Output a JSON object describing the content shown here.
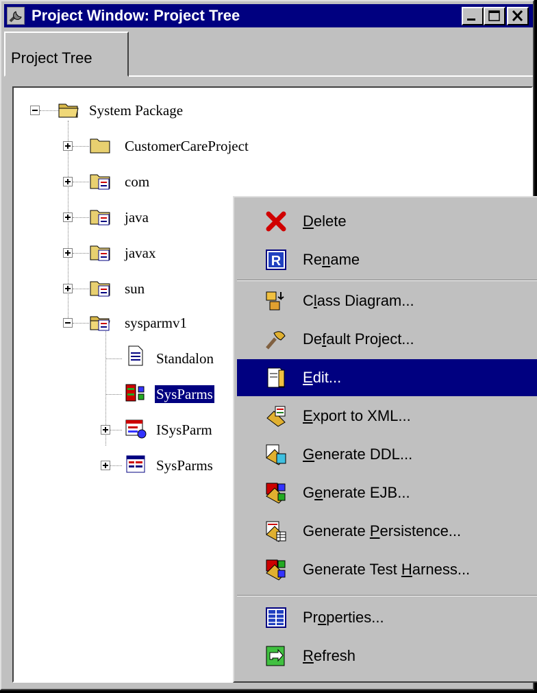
{
  "window": {
    "title": "Project Window: Project Tree"
  },
  "tabs": [
    {
      "label": "Project Tree"
    }
  ],
  "tree": {
    "root": {
      "label": "System Package"
    },
    "children": [
      {
        "label": "CustomerCareProject"
      },
      {
        "label": "com"
      },
      {
        "label": "java"
      },
      {
        "label": "javax"
      },
      {
        "label": "sun"
      },
      {
        "label": "sysparmv1"
      }
    ],
    "sysparmv1_children": [
      {
        "label": "Standalon"
      },
      {
        "label": "SysParms"
      },
      {
        "label": "ISysParm"
      },
      {
        "label": "SysParms"
      }
    ]
  },
  "context_menu": {
    "items": [
      {
        "pre": "",
        "mn": "D",
        "post": "elete",
        "icon": "delete-icon"
      },
      {
        "pre": "Re",
        "mn": "n",
        "post": "ame",
        "icon": "rename-icon"
      },
      {
        "pre": "C",
        "mn": "l",
        "post": "ass Diagram...",
        "icon": "class-diagram-icon"
      },
      {
        "pre": "De",
        "mn": "f",
        "post": "ault Project...",
        "icon": "default-project-icon"
      },
      {
        "pre": "",
        "mn": "E",
        "post": "dit...",
        "icon": "edit-icon",
        "highlighted": true
      },
      {
        "pre": "",
        "mn": "E",
        "post": "xport to XML...",
        "icon": "export-xml-icon"
      },
      {
        "pre": "",
        "mn": "G",
        "post": "enerate DDL...",
        "icon": "generate-ddl-icon"
      },
      {
        "pre": "G",
        "mn": "e",
        "post": "nerate EJB...",
        "icon": "generate-ejb-icon"
      },
      {
        "pre": "Generate ",
        "mn": "P",
        "post": "ersistence...",
        "icon": "generate-persistence-icon"
      },
      {
        "pre": "Generate Test ",
        "mn": "H",
        "post": "arness...",
        "icon": "generate-test-harness-icon"
      },
      {
        "pre": "Pr",
        "mn": "o",
        "post": "perties...",
        "icon": "properties-icon"
      },
      {
        "pre": "",
        "mn": "R",
        "post": "efresh",
        "icon": "refresh-icon"
      }
    ]
  },
  "colors": {
    "titlebar": "#000080",
    "highlight": "#000080",
    "face": "#c0c0c0"
  }
}
